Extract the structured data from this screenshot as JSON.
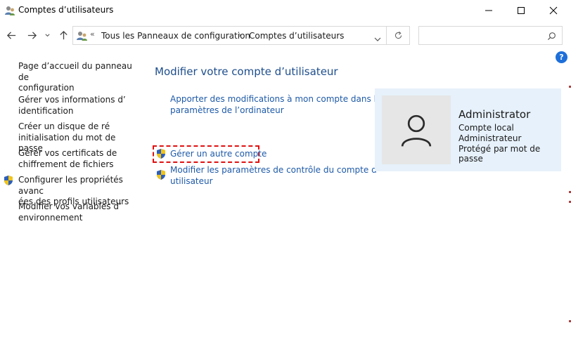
{
  "window": {
    "title": "Comptes d’utilisateurs"
  },
  "address": {
    "chevron": "«",
    "crumbs": [
      "Tous les Panneaux de configuration",
      "Comptes d’utilisateurs"
    ],
    "separator": "›",
    "search_placeholder": ""
  },
  "sidebar": {
    "items": [
      {
        "line1": "Page d’accueil du panneau de",
        "line2": "configuration"
      },
      {
        "line1": "Gérer vos informations d’",
        "line2": "identification"
      },
      {
        "line1": "Créer un disque de ré",
        "line2": "initialisation du mot de passe"
      },
      {
        "line1": "Gérer vos certificats de",
        "line2": "chiffrement de fichiers"
      },
      {
        "line1": "Configurer les propriétés avanc",
        "line2": "ées des profils utilisateurs"
      },
      {
        "line1": "Modifier vos variables d’",
        "line2": "environnement"
      }
    ]
  },
  "main": {
    "title": "Modifier votre compte d’utilisateur",
    "links": [
      {
        "line1": "Apporter des modifications à mon compte dans les",
        "line2": "paramètres de l’ordinateur"
      },
      {
        "line1": "Gérer un autre compte",
        "line2": ""
      },
      {
        "line1": "Modifier les paramètres de contrôle du compte d’",
        "line2": "utilisateur"
      }
    ]
  },
  "user": {
    "name": "Administrator",
    "type": "Compte local",
    "role": "Administrateur",
    "protection": "Protégé par mot de passe"
  },
  "help": {
    "label": "?"
  },
  "colors": {
    "link": "#1e5aa8",
    "title": "#1e4e8c",
    "panel": "#e6f1fb",
    "highlight": "#e01010"
  }
}
